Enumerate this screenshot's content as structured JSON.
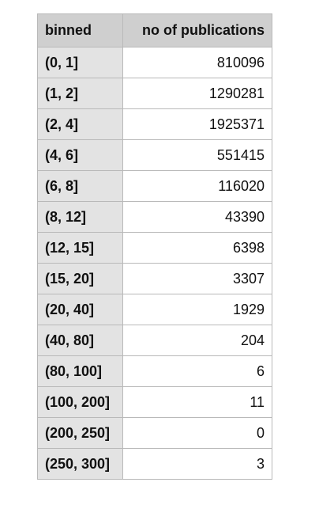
{
  "table": {
    "headers": [
      "binned",
      "no of publications"
    ],
    "rows": [
      [
        "(0, 1]",
        "810096"
      ],
      [
        "(1, 2]",
        "1290281"
      ],
      [
        "(2, 4]",
        "1925371"
      ],
      [
        "(4, 6]",
        "551415"
      ],
      [
        "(6, 8]",
        "116020"
      ],
      [
        "(8, 12]",
        "43390"
      ],
      [
        "(12, 15]",
        "6398"
      ],
      [
        "(15, 20]",
        "3307"
      ],
      [
        "(20, 40]",
        "1929"
      ],
      [
        "(40, 80]",
        "204"
      ],
      [
        "(80, 100]",
        "6"
      ],
      [
        "(100, 200]",
        "11"
      ],
      [
        "(200, 250]",
        "0"
      ],
      [
        "(250, 300]",
        "3"
      ]
    ]
  }
}
